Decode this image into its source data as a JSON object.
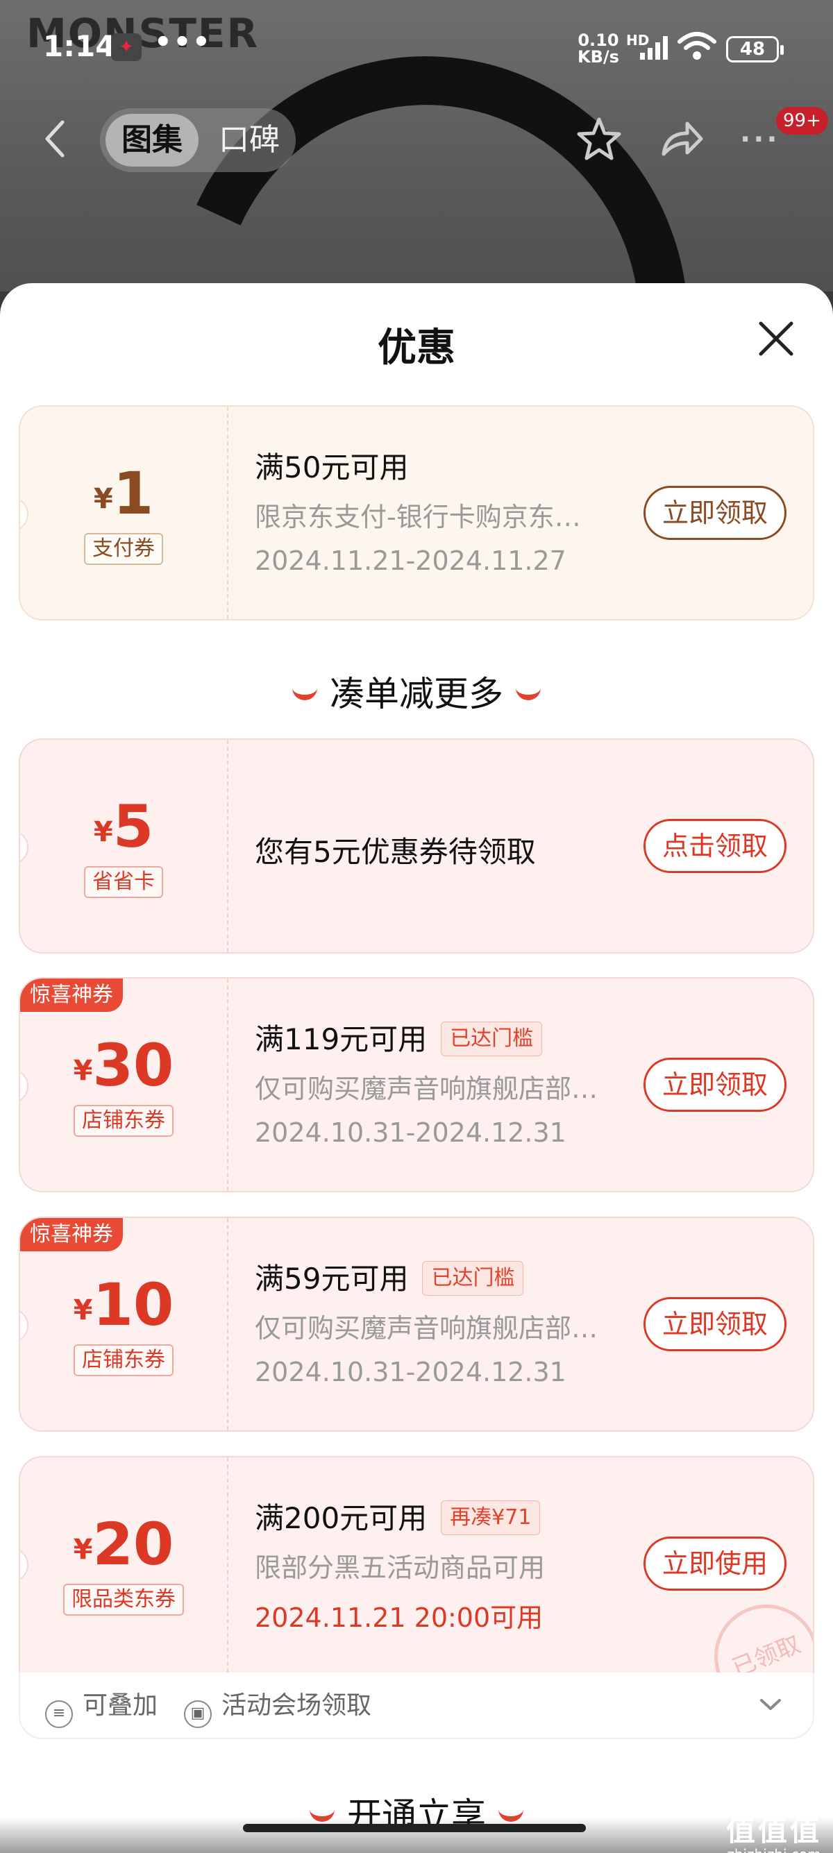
{
  "status_bar": {
    "time": "1:14",
    "dots": "•••",
    "net_speed_value": "0.10",
    "net_speed_unit": "KB/s",
    "hd_label": "HD",
    "battery": "48"
  },
  "background_page": {
    "brand_logo": "MONSTER",
    "tabs": [
      {
        "label": "图集",
        "active": true
      },
      {
        "label": "口碑",
        "active": false
      }
    ],
    "more_badge": "99+"
  },
  "sheet": {
    "title": "优惠"
  },
  "pay_coupon": {
    "currency": "¥",
    "amount": "1",
    "type_label": "支付券",
    "title": "满50元可用",
    "description": "限京东支付-银行卡购京东…",
    "date_range": "2024.11.21-2024.11.27",
    "button_label": "立即领取"
  },
  "section_more": {
    "heading": "凑单减更多"
  },
  "savings_coupon": {
    "currency": "¥",
    "amount": "5",
    "type_label": "省省卡",
    "title": "您有5元优惠券待领取",
    "button_label": "点击领取"
  },
  "store_coupons": [
    {
      "surprise_tag": "惊喜神券",
      "currency": "¥",
      "amount": "30",
      "type_label": "店铺东券",
      "title": "满119元可用",
      "badge": "已达门槛",
      "description": "仅可购买魔声音响旗舰店部…",
      "date_range": "2024.10.31-2024.12.31",
      "button_label": "立即领取"
    },
    {
      "surprise_tag": "惊喜神券",
      "currency": "¥",
      "amount": "10",
      "type_label": "店铺东券",
      "title": "满59元可用",
      "badge": "已达门槛",
      "description": "仅可购买魔声音响旗舰店部…",
      "date_range": "2024.10.31-2024.12.31",
      "button_label": "立即领取"
    }
  ],
  "category_coupon": {
    "currency": "¥",
    "amount": "20",
    "type_label": "限品类东券",
    "title": "满200元可用",
    "badge": "再凑¥71",
    "description": "限部分黑五活动商品可用",
    "start_time": "2024.11.21 20:00可用",
    "button_label": "立即使用",
    "stamp": "已领取"
  },
  "coupon_footer": {
    "features": [
      {
        "label": "可叠加",
        "icon": "stack-icon"
      },
      {
        "label": "活动会场领取",
        "icon": "venue-icon"
      }
    ]
  },
  "section_open": {
    "heading": "开通立享"
  },
  "watermark": {
    "main": "值值值",
    "sub": "zhizhizhi.com"
  },
  "colors": {
    "accent_red": "#dc3826",
    "pay_brown": "#8a4a22",
    "surprise_tag_bg": "#e84a36"
  }
}
